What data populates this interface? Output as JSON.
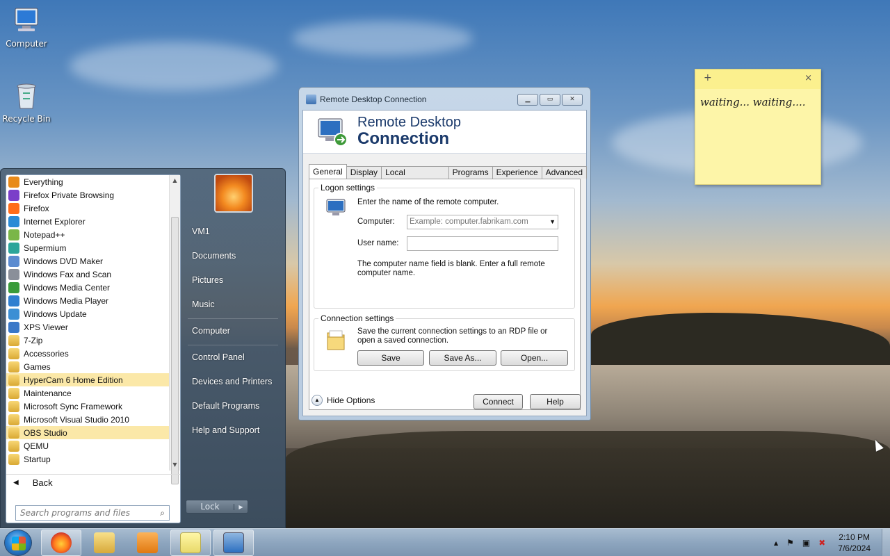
{
  "desktop": {
    "icons": [
      {
        "label": "Computer",
        "icon": "computer-icon"
      },
      {
        "label": "Recycle Bin",
        "icon": "recycle-bin-icon"
      }
    ]
  },
  "start_menu": {
    "programs": [
      {
        "label": "Everything",
        "icon": "search-magnifier-icon",
        "highlight": false
      },
      {
        "label": "Firefox Private Browsing",
        "icon": "firefox-private-icon",
        "highlight": false
      },
      {
        "label": "Firefox",
        "icon": "firefox-icon",
        "highlight": false
      },
      {
        "label": "Internet Explorer",
        "icon": "ie-icon",
        "highlight": false
      },
      {
        "label": "Notepad++",
        "icon": "notepadpp-icon",
        "highlight": false
      },
      {
        "label": "Supermium",
        "icon": "supermium-icon",
        "highlight": false
      },
      {
        "label": "Windows DVD Maker",
        "icon": "dvd-maker-icon",
        "highlight": false
      },
      {
        "label": "Windows Fax and Scan",
        "icon": "fax-icon",
        "highlight": false
      },
      {
        "label": "Windows Media Center",
        "icon": "media-center-icon",
        "highlight": false
      },
      {
        "label": "Windows Media Player",
        "icon": "media-player-icon",
        "highlight": false
      },
      {
        "label": "Windows Update",
        "icon": "windows-update-icon",
        "highlight": false
      },
      {
        "label": "XPS Viewer",
        "icon": "xps-viewer-icon",
        "highlight": false
      },
      {
        "label": "7-Zip",
        "icon": "folder-icon",
        "highlight": false
      },
      {
        "label": "Accessories",
        "icon": "folder-icon",
        "highlight": false
      },
      {
        "label": "Games",
        "icon": "folder-icon",
        "highlight": false
      },
      {
        "label": "HyperCam 6 Home Edition",
        "icon": "folder-icon",
        "highlight": true
      },
      {
        "label": "Maintenance",
        "icon": "folder-icon",
        "highlight": false
      },
      {
        "label": "Microsoft Sync Framework",
        "icon": "folder-icon",
        "highlight": false
      },
      {
        "label": "Microsoft Visual Studio 2010",
        "icon": "folder-icon",
        "highlight": false
      },
      {
        "label": "OBS Studio",
        "icon": "folder-icon",
        "highlight": true
      },
      {
        "label": "QEMU",
        "icon": "folder-icon",
        "highlight": false
      },
      {
        "label": "Startup",
        "icon": "folder-icon",
        "highlight": false
      }
    ],
    "back_label": "Back",
    "search_placeholder": "Search programs and files",
    "right_links": {
      "user": "VM1",
      "documents": "Documents",
      "pictures": "Pictures",
      "music": "Music",
      "computer": "Computer",
      "control_panel": "Control Panel",
      "devices": "Devices and Printers",
      "default_programs": "Default Programs",
      "help": "Help and Support"
    },
    "lock_label": "Lock"
  },
  "rdc": {
    "window_title": "Remote Desktop Connection",
    "banner_line1": "Remote Desktop",
    "banner_line2": "Connection",
    "tabs": [
      "General",
      "Display",
      "Local Resources",
      "Programs",
      "Experience",
      "Advanced"
    ],
    "active_tab": "General",
    "logon": {
      "group_label": "Logon settings",
      "instruction": "Enter the name of the remote computer.",
      "computer_label": "Computer:",
      "computer_placeholder": "Example: computer.fabrikam.com",
      "username_label": "User name:",
      "username_value": "",
      "warning": "The computer name field is blank. Enter a full remote computer name."
    },
    "connection": {
      "group_label": "Connection settings",
      "description": "Save the current connection settings to an RDP file or open a saved connection.",
      "save": "Save",
      "save_as": "Save As...",
      "open": "Open..."
    },
    "hide_options": "Hide Options",
    "connect": "Connect",
    "help": "Help"
  },
  "sticky_note": {
    "text": "waiting... waiting....",
    "add": "+",
    "close": "×"
  },
  "taskbar": {
    "items": [
      "firefox-icon",
      "explorer-icon",
      "media-player-icon",
      "sticky-notes-icon",
      "remote-desktop-icon"
    ],
    "clock_time": "2:10 PM",
    "clock_date": "7/6/2024",
    "tray": {
      "expand": "▲",
      "flag": "⚑",
      "network": "▣",
      "volume": "✖"
    }
  }
}
